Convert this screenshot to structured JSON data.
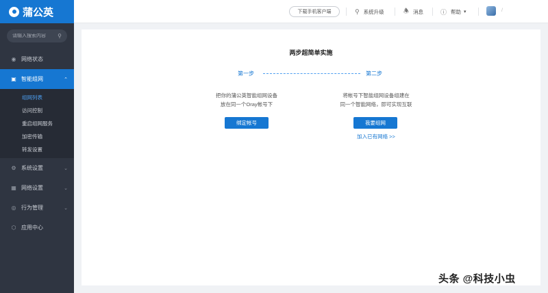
{
  "app": {
    "logo_text": "蒲公英"
  },
  "search": {
    "placeholder": "请输入搜索内容"
  },
  "sidebar": {
    "items": [
      {
        "label": "网络状态",
        "icon": "globe-icon"
      },
      {
        "label": "智能组网",
        "icon": "network-icon",
        "active": true
      },
      {
        "label": "系统设置",
        "icon": "gear-icon"
      },
      {
        "label": "网络设置",
        "icon": "network-settings-icon"
      },
      {
        "label": "行为管理",
        "icon": "behavior-icon"
      },
      {
        "label": "应用中心",
        "icon": "app-center-icon"
      }
    ],
    "sub_items": [
      {
        "label": "组网列表",
        "selected": true
      },
      {
        "label": "访问控制"
      },
      {
        "label": "重启组网服务"
      },
      {
        "label": "加密传输"
      },
      {
        "label": "转发设置"
      }
    ]
  },
  "topbar": {
    "download_label": "下载手机客户端",
    "upgrade_label": "系统升级",
    "messages_label": "消息",
    "help_label": "帮助",
    "user_name": "/"
  },
  "main": {
    "title": "两步超简单实施",
    "step1_label": "第一步",
    "step2_label": "第二步",
    "step1_desc_line1": "把你的蒲公英智能组网设备",
    "step1_desc_line2": "放在同一个Oray帐号下",
    "step2_desc_line1": "将帐号下智能组网设备组建在",
    "step2_desc_line2": "同一个智能网络，即可实现互联",
    "bind_button": "绑定帐号",
    "create_button": "我要组网",
    "join_link": "加入已有网络 >>"
  },
  "watermark": "头条 @科技小虫",
  "colors": {
    "brand": "#1677d2",
    "sidebar_bg": "#2f3541",
    "page_bg": "#f0f2f5"
  }
}
